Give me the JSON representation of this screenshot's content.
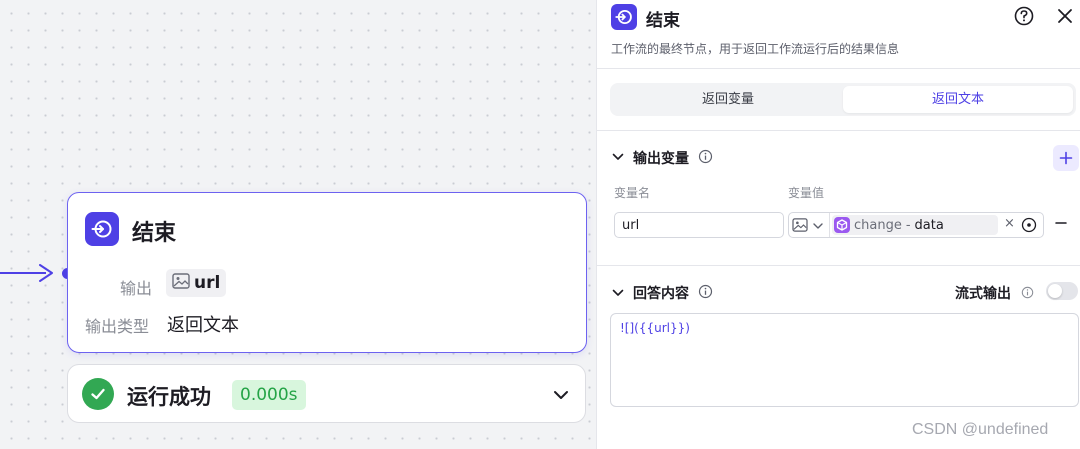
{
  "colors": {
    "accent": "#4e40e5",
    "success": "#32a853",
    "success_bg": "#d8f6dd",
    "ref_node": "#9b59f0"
  },
  "canvas": {
    "node": {
      "title": "结束",
      "icon": "end-node-icon",
      "output_label": "输出",
      "output_var": "url",
      "output_var_icon": "image-icon",
      "output_type_label": "输出类型",
      "output_type_value": "返回文本"
    },
    "run_status": {
      "text": "运行成功",
      "duration": "0.000s",
      "icon": "check-circle-icon"
    }
  },
  "panel": {
    "title": "结束",
    "description": "工作流的最终节点，用于返回工作流运行后的结果信息",
    "tabs": [
      {
        "label": "返回变量",
        "active": false
      },
      {
        "label": "返回文本",
        "active": true
      }
    ],
    "output_section": {
      "title": "输出变量",
      "col_name": "变量名",
      "col_value": "变量值",
      "rows": [
        {
          "name": "url",
          "type_icon": "image-icon",
          "ref_node": "change",
          "ref_sep": "-",
          "ref_var": "data",
          "clear": "×"
        }
      ]
    },
    "answer_section": {
      "title": "回答内容",
      "stream_label": "流式输出",
      "stream_enabled": false,
      "content": "![]({{url}})"
    }
  },
  "watermark": "CSDN @undefined"
}
